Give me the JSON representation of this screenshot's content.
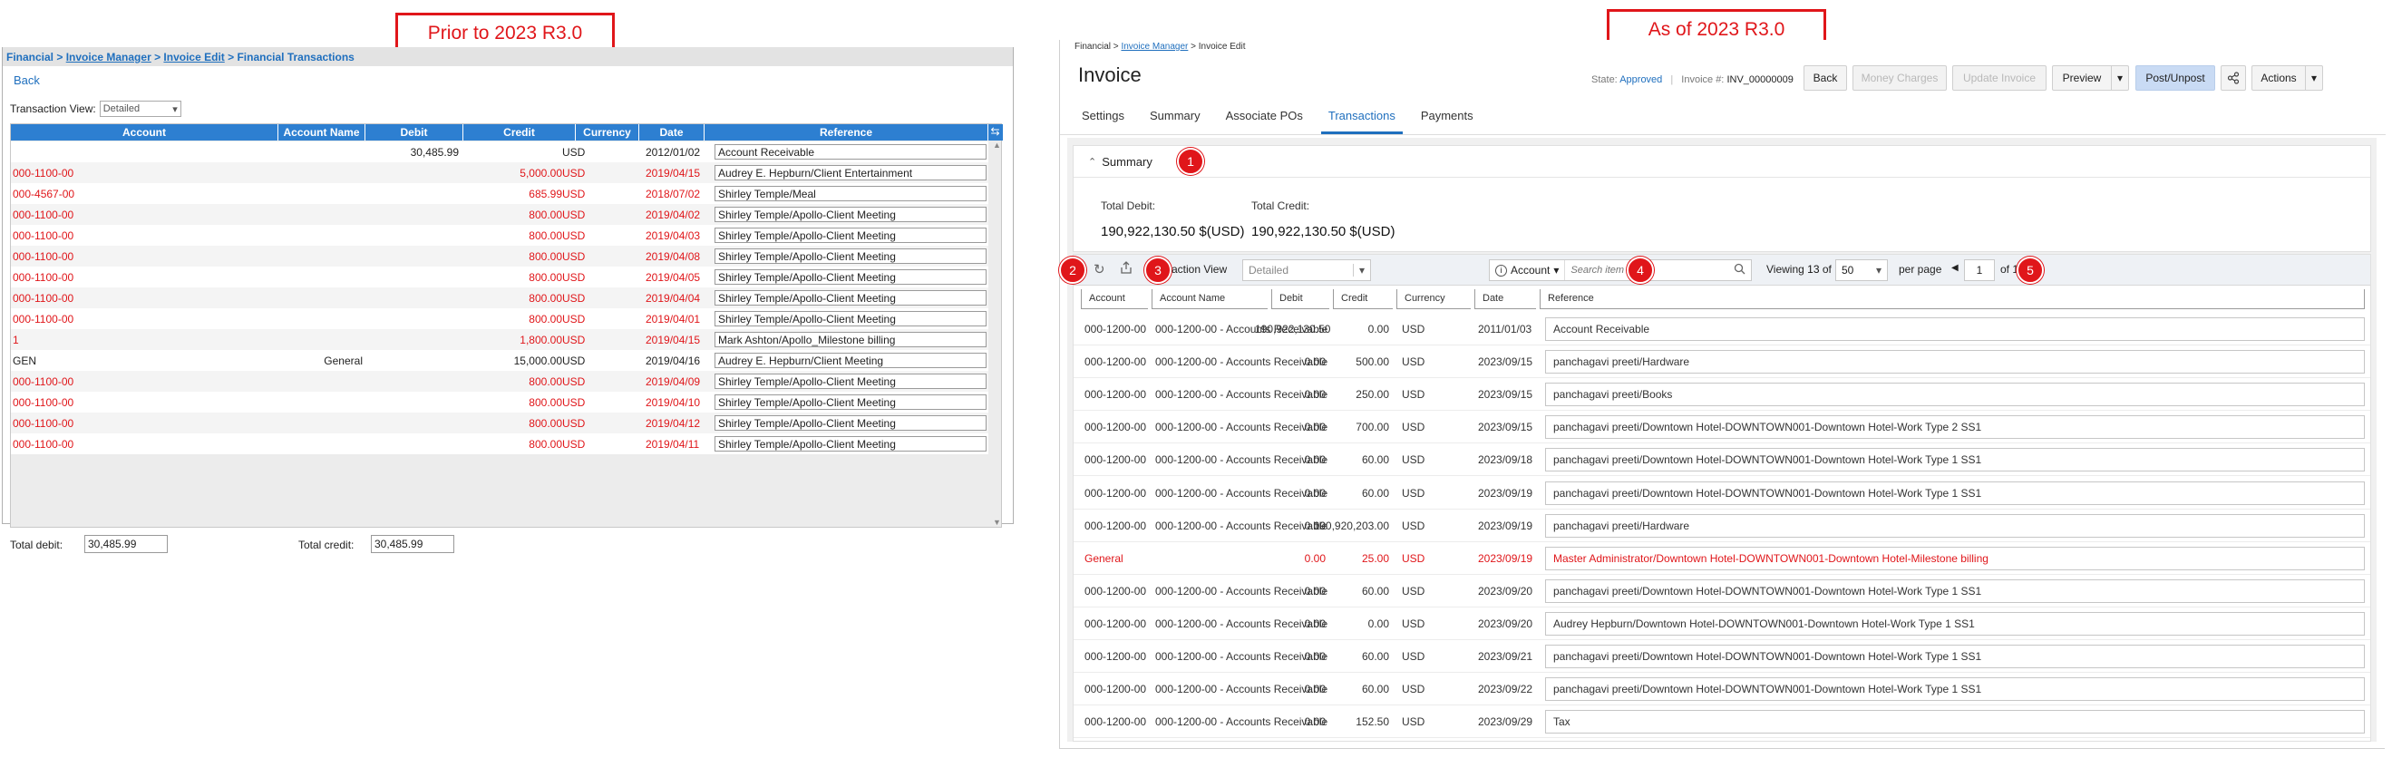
{
  "callouts": {
    "prior": "Prior to 2023 R3.0",
    "current": "As of 2023 R3.0"
  },
  "colors": {
    "link": "#1f6fbe",
    "old_header": "#2d7fd1",
    "highlight": "#e0161a",
    "primary_btn": "#c9dbf4"
  },
  "old_ui": {
    "breadcrumb": {
      "root": "Financial",
      "invoice_manager": "Invoice Manager",
      "invoice_edit": "Invoice Edit",
      "current": "Financial Transactions"
    },
    "back": "Back",
    "transaction_view": {
      "label": "Transaction View:",
      "value": "Detailed"
    },
    "columns": [
      "Account",
      "Account Name",
      "Debit",
      "Credit",
      "Currency",
      "Date",
      "Reference"
    ],
    "rows": [
      {
        "account": "",
        "account_name": "",
        "debit": "30,485.99",
        "credit": "",
        "currency": "USD",
        "date": "2012/01/02",
        "reference": "Account Receivable",
        "red": false
      },
      {
        "account": "000-1100-00",
        "account_name": "",
        "debit": "",
        "credit": "5,000.00",
        "currency": "USD",
        "date": "2019/04/15",
        "reference": "Audrey E. Hepburn/Client Entertainment",
        "red": true
      },
      {
        "account": "000-4567-00",
        "account_name": "",
        "debit": "",
        "credit": "685.99",
        "currency": "USD",
        "date": "2018/07/02",
        "reference": "Shirley Temple/Meal",
        "red": true
      },
      {
        "account": "000-1100-00",
        "account_name": "",
        "debit": "",
        "credit": "800.00",
        "currency": "USD",
        "date": "2019/04/02",
        "reference": "Shirley Temple/Apollo-Client Meeting",
        "red": true
      },
      {
        "account": "000-1100-00",
        "account_name": "",
        "debit": "",
        "credit": "800.00",
        "currency": "USD",
        "date": "2019/04/03",
        "reference": "Shirley Temple/Apollo-Client Meeting",
        "red": true
      },
      {
        "account": "000-1100-00",
        "account_name": "",
        "debit": "",
        "credit": "800.00",
        "currency": "USD",
        "date": "2019/04/08",
        "reference": "Shirley Temple/Apollo-Client Meeting",
        "red": true
      },
      {
        "account": "000-1100-00",
        "account_name": "",
        "debit": "",
        "credit": "800.00",
        "currency": "USD",
        "date": "2019/04/05",
        "reference": "Shirley Temple/Apollo-Client Meeting",
        "red": true
      },
      {
        "account": "000-1100-00",
        "account_name": "",
        "debit": "",
        "credit": "800.00",
        "currency": "USD",
        "date": "2019/04/04",
        "reference": "Shirley Temple/Apollo-Client Meeting",
        "red": true
      },
      {
        "account": "000-1100-00",
        "account_name": "",
        "debit": "",
        "credit": "800.00",
        "currency": "USD",
        "date": "2019/04/01",
        "reference": "Shirley Temple/Apollo-Client Meeting",
        "red": true
      },
      {
        "account": "1",
        "account_name": "",
        "debit": "",
        "credit": "1,800.00",
        "currency": "USD",
        "date": "2019/04/15",
        "reference": "Mark Ashton/Apollo_Milestone billing",
        "red": true
      },
      {
        "account": "GEN",
        "account_name": "General",
        "debit": "",
        "credit": "15,000.00",
        "currency": "USD",
        "date": "2019/04/16",
        "reference": "Audrey E. Hepburn/Client Meeting",
        "red": false
      },
      {
        "account": "000-1100-00",
        "account_name": "",
        "debit": "",
        "credit": "800.00",
        "currency": "USD",
        "date": "2019/04/09",
        "reference": "Shirley Temple/Apollo-Client Meeting",
        "red": true
      },
      {
        "account": "000-1100-00",
        "account_name": "",
        "debit": "",
        "credit": "800.00",
        "currency": "USD",
        "date": "2019/04/10",
        "reference": "Shirley Temple/Apollo-Client Meeting",
        "red": true
      },
      {
        "account": "000-1100-00",
        "account_name": "",
        "debit": "",
        "credit": "800.00",
        "currency": "USD",
        "date": "2019/04/12",
        "reference": "Shirley Temple/Apollo-Client Meeting",
        "red": true
      },
      {
        "account": "000-1100-00",
        "account_name": "",
        "debit": "",
        "credit": "800.00",
        "currency": "USD",
        "date": "2019/04/11",
        "reference": "Shirley Temple/Apollo-Client Meeting",
        "red": true
      }
    ],
    "totals": {
      "debit_label": "Total debit:",
      "debit": "30,485.99",
      "credit_label": "Total credit:",
      "credit": "30,485.99"
    }
  },
  "new_ui": {
    "breadcrumb": {
      "root": "Financial",
      "invoice_manager": "Invoice Manager",
      "current": "Invoice Edit"
    },
    "title": "Invoice",
    "state": {
      "label": "State:",
      "value": "Approved",
      "invoice_label": "Invoice #:",
      "invoice_number": "INV_00000009"
    },
    "buttons": {
      "back": "Back",
      "money_charges": "Money Charges",
      "update_invoice": "Update Invoice",
      "preview": "Preview",
      "post_unpost": "Post/Unpost",
      "actions": "Actions"
    },
    "tabs": [
      "Settings",
      "Summary",
      "Associate POs",
      "Transactions",
      "Payments"
    ],
    "summary": {
      "title": "Summary",
      "total_debit_label": "Total Debit:",
      "total_debit": "190,922,130.50 $(USD)",
      "total_credit_label": "Total Credit:",
      "total_credit": "190,922,130.50 $(USD)"
    },
    "toolbar": {
      "transaction_view_label": "action View",
      "transaction_view_value": "Detailed",
      "search_field": "Account",
      "search_placeholder": "Search item",
      "viewing_prefix": "Viewing",
      "viewing_count": "13",
      "viewing_of": "of 13",
      "per_page_value": "50",
      "per_page_label": "per page",
      "page_value": "1",
      "page_of": "of 1"
    },
    "columns": [
      "Account",
      "Account Name",
      "Debit",
      "Credit",
      "Currency",
      "Date",
      "Reference"
    ],
    "rows": [
      {
        "account": "000-1200-00",
        "account_name": "000-1200-00 - Accounts Receivable",
        "debit": "190,922,130.50",
        "credit": "0.00",
        "currency": "USD",
        "date": "2011/01/03",
        "reference": "Account Receivable",
        "red": false
      },
      {
        "account": "000-1200-00",
        "account_name": "000-1200-00 - Accounts Receivable",
        "debit": "0.00",
        "credit": "500.00",
        "currency": "USD",
        "date": "2023/09/15",
        "reference": "panchagavi preeti/Hardware",
        "red": false
      },
      {
        "account": "000-1200-00",
        "account_name": "000-1200-00 - Accounts Receivable",
        "debit": "0.00",
        "credit": "250.00",
        "currency": "USD",
        "date": "2023/09/15",
        "reference": "panchagavi preeti/Books",
        "red": false
      },
      {
        "account": "000-1200-00",
        "account_name": "000-1200-00 - Accounts Receivable",
        "debit": "0.00",
        "credit": "700.00",
        "currency": "USD",
        "date": "2023/09/15",
        "reference": "panchagavi preeti/Downtown Hotel-DOWNTOWN001-Downtown Hotel-Work Type 2 SS1",
        "red": false
      },
      {
        "account": "000-1200-00",
        "account_name": "000-1200-00 - Accounts Receivable",
        "debit": "0.00",
        "credit": "60.00",
        "currency": "USD",
        "date": "2023/09/18",
        "reference": "panchagavi preeti/Downtown Hotel-DOWNTOWN001-Downtown Hotel-Work Type 1 SS1",
        "red": false
      },
      {
        "account": "000-1200-00",
        "account_name": "000-1200-00 - Accounts Receivable",
        "debit": "0.00",
        "credit": "60.00",
        "currency": "USD",
        "date": "2023/09/19",
        "reference": "panchagavi preeti/Downtown Hotel-DOWNTOWN001-Downtown Hotel-Work Type 1 SS1",
        "red": false
      },
      {
        "account": "000-1200-00",
        "account_name": "000-1200-00 - Accounts Receivable",
        "debit": "0.00",
        "credit": "190,920,203.00",
        "currency": "USD",
        "date": "2023/09/19",
        "reference": "panchagavi preeti/Hardware",
        "red": false
      },
      {
        "account": "General",
        "account_name": "",
        "debit": "0.00",
        "credit": "25.00",
        "currency": "USD",
        "date": "2023/09/19",
        "reference": "Master Administrator/Downtown Hotel-DOWNTOWN001-Downtown Hotel-Milestone billing",
        "red": true
      },
      {
        "account": "000-1200-00",
        "account_name": "000-1200-00 - Accounts Receivable",
        "debit": "0.00",
        "credit": "60.00",
        "currency": "USD",
        "date": "2023/09/20",
        "reference": "panchagavi preeti/Downtown Hotel-DOWNTOWN001-Downtown Hotel-Work Type 1 SS1",
        "red": false
      },
      {
        "account": "000-1200-00",
        "account_name": "000-1200-00 - Accounts Receivable",
        "debit": "0.00",
        "credit": "0.00",
        "currency": "USD",
        "date": "2023/09/20",
        "reference": "Audrey Hepburn/Downtown Hotel-DOWNTOWN001-Downtown Hotel-Work Type 1 SS1",
        "red": false
      },
      {
        "account": "000-1200-00",
        "account_name": "000-1200-00 - Accounts Receivable",
        "debit": "0.00",
        "credit": "60.00",
        "currency": "USD",
        "date": "2023/09/21",
        "reference": "panchagavi preeti/Downtown Hotel-DOWNTOWN001-Downtown Hotel-Work Type 1 SS1",
        "red": false
      },
      {
        "account": "000-1200-00",
        "account_name": "000-1200-00 - Accounts Receivable",
        "debit": "0.00",
        "credit": "60.00",
        "currency": "USD",
        "date": "2023/09/22",
        "reference": "panchagavi preeti/Downtown Hotel-DOWNTOWN001-Downtown Hotel-Work Type 1 SS1",
        "red": false
      },
      {
        "account": "000-1200-00",
        "account_name": "000-1200-00 - Accounts Receivable",
        "debit": "0.00",
        "credit": "152.50",
        "currency": "USD",
        "date": "2023/09/29",
        "reference": "Tax",
        "red": false
      }
    ],
    "badges": [
      "1",
      "2",
      "3",
      "4",
      "5"
    ]
  }
}
